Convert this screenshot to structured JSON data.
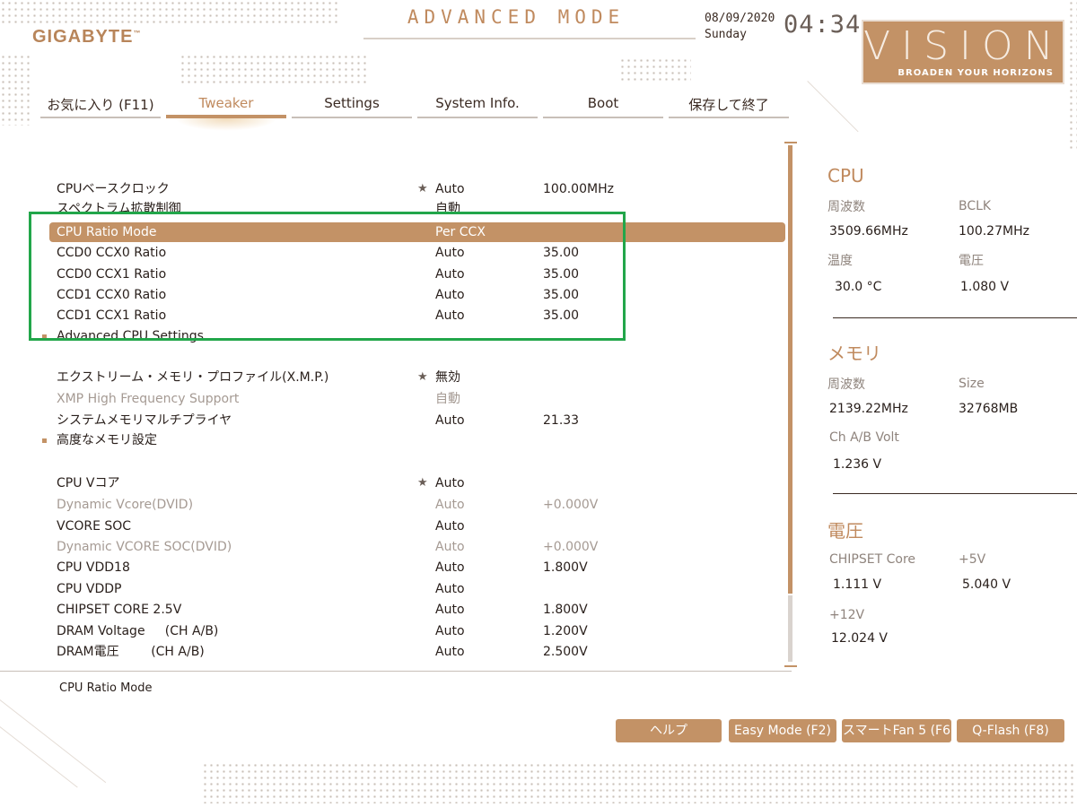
{
  "header": {
    "logo": "GIGABYTE",
    "mode_title": "ADVANCED MODE",
    "date": "08/09/2020",
    "weekday": "Sunday",
    "time": "04:34",
    "vision_title": "VISION",
    "vision_tagline": "BROADEN YOUR HORIZONS"
  },
  "tabs": [
    {
      "label": "お気に入り (F11)"
    },
    {
      "label": "Tweaker"
    },
    {
      "label": "Settings"
    },
    {
      "label": "System Info."
    },
    {
      "label": "Boot"
    },
    {
      "label": "保存して終了"
    }
  ],
  "settings": [
    {
      "name": "CPUベースクロック",
      "value": "Auto",
      "value2": "100.00MHz",
      "star": "★"
    },
    {
      "name": "スペクトラム拡散制御",
      "value": "自動",
      "value2": ""
    },
    {
      "name": "CPU Ratio Mode",
      "value": "Per CCX",
      "value2": ""
    },
    {
      "name": "CCD0 CCX0 Ratio",
      "value": "Auto",
      "value2": "35.00"
    },
    {
      "name": "CCD0 CCX1 Ratio",
      "value": "Auto",
      "value2": "35.00"
    },
    {
      "name": "CCD1 CCX0  Ratio",
      "value": "Auto",
      "value2": "35.00"
    },
    {
      "name": "CCD1 CCX1  Ratio",
      "value": "Auto",
      "value2": "35.00"
    },
    {
      "name": "Advanced CPU Settings",
      "value": "",
      "value2": ""
    },
    {
      "name": "エクストリーム・メモリ・プロファイル(X.M.P.)",
      "value": "無効",
      "value2": "",
      "star": "★"
    },
    {
      "name": "XMP High Frequency Support",
      "value": "自動",
      "value2": ""
    },
    {
      "name": "システムメモリマルチプライヤ",
      "value": "Auto",
      "value2": "21.33"
    },
    {
      "name": "高度なメモリ設定",
      "value": "",
      "value2": ""
    },
    {
      "name": "CPU Vコア",
      "value": "Auto",
      "value2": "",
      "star": "★"
    },
    {
      "name": "Dynamic Vcore(DVID)",
      "value": "Auto",
      "value2": "+0.000V"
    },
    {
      "name": "VCORE SOC",
      "value": "Auto",
      "value2": ""
    },
    {
      "name": "Dynamic VCORE SOC(DVID)",
      "value": "Auto",
      "value2": "+0.000V"
    },
    {
      "name": "CPU VDD18",
      "value": "Auto",
      "value2": "1.800V"
    },
    {
      "name": "CPU VDDP",
      "value": "Auto",
      "value2": ""
    },
    {
      "name": "CHIPSET CORE 2.5V",
      "value": "Auto",
      "value2": "1.800V"
    },
    {
      "name": "DRAM Voltage     (CH A/B)",
      "value": "Auto",
      "value2": "1.200V"
    },
    {
      "name": "DRAM電圧        (CH A/B)",
      "value": "Auto",
      "value2": "2.500V"
    }
  ],
  "help_text": "CPU Ratio Mode",
  "sidebar": {
    "cpu": {
      "title": "CPU",
      "freq_label": "周波数",
      "freq_value": "3509.66MHz",
      "bclk_label": "BCLK",
      "bclk_value": "100.27MHz",
      "temp_label": "温度",
      "temp_value": "30.0 °C",
      "volt_label": "電圧",
      "volt_value": "1.080 V"
    },
    "memory": {
      "title": "メモリ",
      "freq_label": "周波数",
      "freq_value": "2139.22MHz",
      "size_label": "Size",
      "size_value": "32768MB",
      "volt_label": "Ch A/B Volt",
      "volt_value": "1.236 V"
    },
    "voltage": {
      "title": "電圧",
      "chipset_label": "CHIPSET Core",
      "chipset_value": "1.111 V",
      "v5_label": "+5V",
      "v5_value": "5.040 V",
      "v12_label": "+12V",
      "v12_value": "12.024 V"
    }
  },
  "footer_buttons": [
    {
      "label": "ヘルプ"
    },
    {
      "label": "Easy Mode (F2)"
    },
    {
      "label": "スマートFan 5 (F6"
    },
    {
      "label": "Q-Flash (F8)"
    }
  ],
  "colors": {
    "accent": "#c39266",
    "highlight_box": "#22a64a"
  }
}
